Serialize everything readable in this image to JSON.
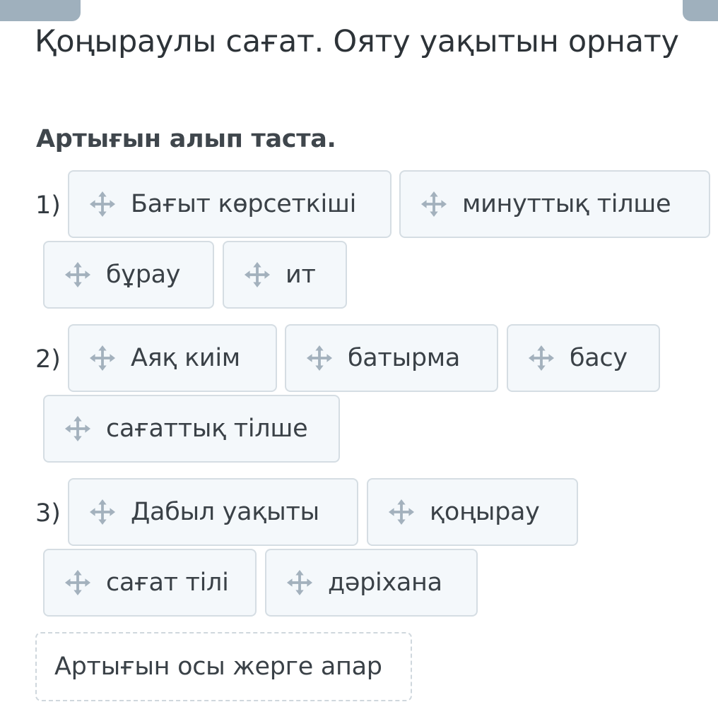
{
  "header": {
    "title": "Қоңыраулы сағат. Ояту уақытын орнату"
  },
  "instruction": "Артығын алып таста.",
  "questions": [
    {
      "number": "1)",
      "options": [
        "Бағыт көрсеткіші",
        "минуттық тілше",
        "бұрау",
        "ит"
      ]
    },
    {
      "number": "2)",
      "options": [
        "Аяқ киім",
        "батырма",
        "басу",
        "сағаттық тілше"
      ]
    },
    {
      "number": "3)",
      "options": [
        "Дабыл уақыты",
        "қоңырау",
        "сағат тілі",
        "дәріхана"
      ]
    }
  ],
  "dropzone": {
    "label": "Артығын осы жерге апар"
  },
  "icons": {
    "chip_icon": "move-arrows-icon"
  },
  "colors": {
    "chip_background": "#f4f8fb",
    "chip_border": "#d5dde3",
    "icon": "#a3b1bd",
    "top_tab": "#9fb0bd",
    "text": "#333a40"
  }
}
